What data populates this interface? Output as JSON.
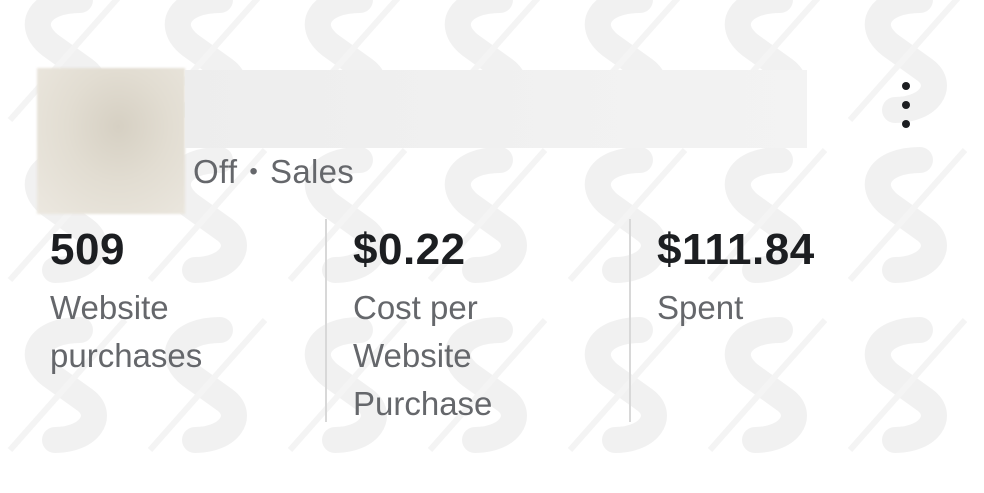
{
  "campaign": {
    "status": "Off",
    "separator": "•",
    "objective": "Sales"
  },
  "metrics": [
    {
      "value": "509",
      "label": "Website purchases"
    },
    {
      "value": "$0.22",
      "label": "Cost per Website Purchase"
    },
    {
      "value": "$111.84",
      "label": "Spent"
    }
  ],
  "icons": {
    "menu": "more-vertical-icon"
  },
  "colors": {
    "text_primary": "#1c1e21",
    "text_secondary": "#65676b",
    "divider": "#d8d8d8",
    "background": "#ffffff"
  }
}
